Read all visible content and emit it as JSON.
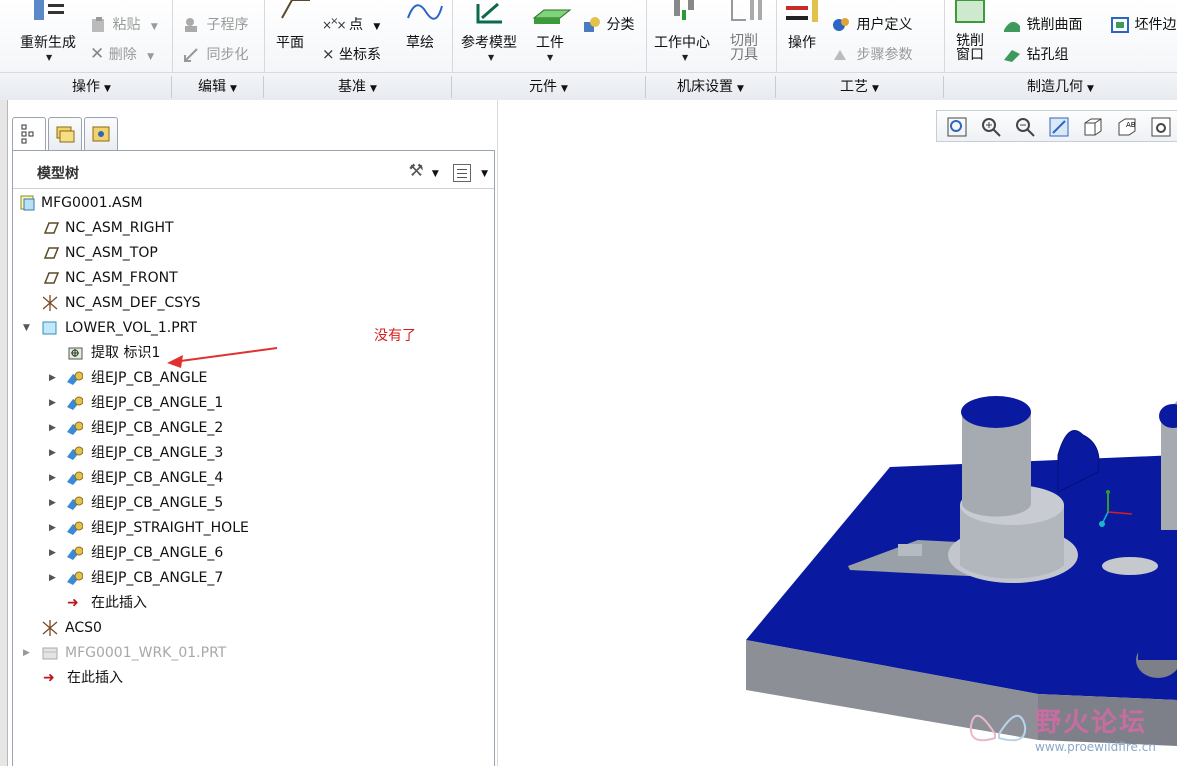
{
  "ribbon": {
    "groups": [
      {
        "label": "操作"
      },
      {
        "label": "编辑"
      },
      {
        "label": "基准"
      },
      {
        "label": "元件"
      },
      {
        "label": "机床设置"
      },
      {
        "label": "工艺"
      },
      {
        "label": "制造几何"
      }
    ],
    "regenerate": "重新生成",
    "paste": "粘贴",
    "delete": "删除",
    "subroutine": "子程序",
    "sync": "同步化",
    "plane": "平面",
    "point": "点",
    "csys": "坐标系",
    "sketch": "草绘",
    "ref_model": "参考模型",
    "workpiece": "工件",
    "classify": "分类",
    "work_center": "工作中心",
    "cutting_tool_1": "切削",
    "cutting_tool_2": "刀具",
    "operation": "操作",
    "user_defined": "用户定义",
    "step_params": "步骤参数",
    "mill_window_1": "铣削",
    "mill_window_2": "窗口",
    "mill_surface": "铣削曲面",
    "drill_group": "钻孔组",
    "stock_boundary": "坯件边"
  },
  "model_tree": {
    "title": "模型树",
    "items": [
      {
        "label": "MFG0001.ASM"
      },
      {
        "label": "NC_ASM_RIGHT"
      },
      {
        "label": "NC_ASM_TOP"
      },
      {
        "label": "NC_ASM_FRONT"
      },
      {
        "label": "NC_ASM_DEF_CSYS"
      },
      {
        "label": "LOWER_VOL_1.PRT"
      },
      {
        "label": "提取 标识1"
      },
      {
        "label": "组EJP_CB_ANGLE"
      },
      {
        "label": "组EJP_CB_ANGLE_1"
      },
      {
        "label": "组EJP_CB_ANGLE_2"
      },
      {
        "label": "组EJP_CB_ANGLE_3"
      },
      {
        "label": "组EJP_CB_ANGLE_4"
      },
      {
        "label": "组EJP_CB_ANGLE_5"
      },
      {
        "label": "组EJP_STRAIGHT_HOLE"
      },
      {
        "label": "组EJP_CB_ANGLE_6"
      },
      {
        "label": "组EJP_CB_ANGLE_7"
      },
      {
        "label": "在此插入"
      },
      {
        "label": "ACS0"
      },
      {
        "label": "MFG0001_WRK_01.PRT"
      },
      {
        "label": "在此插入"
      }
    ]
  },
  "annotation": "没有了",
  "watermark": {
    "name": "野火论坛",
    "url": "www.proewildfire.cn"
  },
  "colors": {
    "model_blue": "#0a1aa0",
    "model_gray": "#8c8f96",
    "annotation_red": "#e03030"
  }
}
